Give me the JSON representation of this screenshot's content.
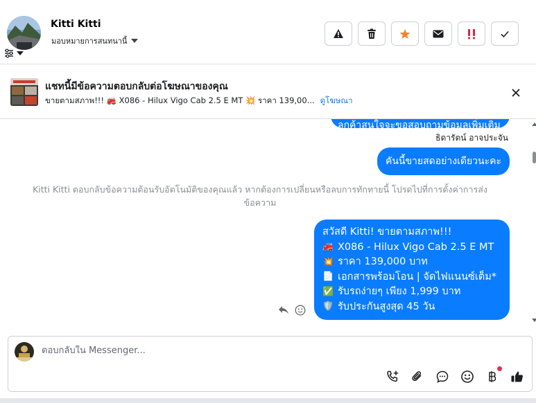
{
  "header": {
    "contact_name": "Kitti Kitti",
    "assign_label": "มอบหมายการสนทนานี้",
    "actions": [
      {
        "name": "report-spam",
        "icon": "warning-icon"
      },
      {
        "name": "delete",
        "icon": "trash-icon"
      },
      {
        "name": "star",
        "icon": "star-icon"
      },
      {
        "name": "mark-unread",
        "icon": "envelope-icon"
      },
      {
        "name": "follow-up",
        "icon": "double-exclamation-icon"
      },
      {
        "name": "mark-done",
        "icon": "check-icon"
      }
    ]
  },
  "banner": {
    "title": "แชทนี้มีข้อความตอบกลับต่อโฆษณาของคุณ",
    "ad_text": "ขายตามสภาพ!!! 🚒 X086 - Hilux Vigo Cab 2.5 E MT 💥 ราคา 139,00...",
    "link_label": "ดูโฆษณา"
  },
  "conversation": {
    "prev_bubble_text": "ลูกค้าสนใจจะขอสอบถามข้อมูลเพิ่มเติม",
    "sender_name": "ธิดารัตน์ อาจประจัน",
    "bubble_mid": "คันนี้ขายสดอย่างเดียวนะคะ",
    "system_note": "Kitti Kitti ตอบกลับข้อความต้อนรับอัตโนมัติของคุณแล้ว หากต้องการเปลี่ยนหรือลบการทักทายนี้ โปรดไปที่การตั้งค่าการส่งข้อความ",
    "main_bubble": {
      "greeting": "สวัสดี Kitti! ขายตามสภาพ!!!",
      "lines": [
        {
          "icon": "🚒",
          "text": "X086 - Hilux Vigo Cab 2.5 E MT"
        },
        {
          "icon": "💥",
          "text": "ราคา 139,000 บาท"
        },
        {
          "icon": "📄",
          "text": "เอกสารพร้อมโอน | จัดไฟแนนซ์เต็ม*"
        },
        {
          "icon": "✅",
          "text": "รับรถง่ายๆ เพียง 1,999 บาท"
        },
        {
          "icon": "🛡️",
          "text": "รับประกันสูงสุด 45 วัน"
        }
      ]
    }
  },
  "composer": {
    "placeholder": "ตอบกลับใน Messenger...",
    "tools": [
      "phone-add-icon",
      "paperclip-icon",
      "chat-bubble-icon",
      "emoji-icon",
      "baht-icon",
      "thumbs-up-icon"
    ]
  },
  "colors": {
    "accent": "#0a7cff",
    "link": "#1877f2",
    "star": "#f5822a",
    "follow_up": "#e41e3f",
    "notification_dot": "#f02849"
  }
}
